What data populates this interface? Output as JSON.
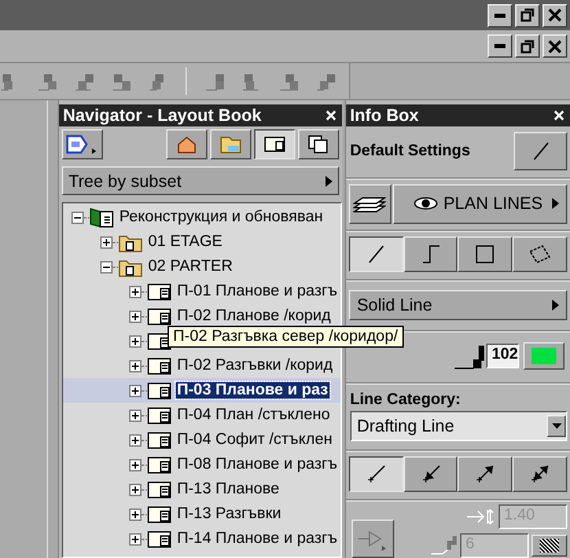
{
  "navigator": {
    "title": "Navigator - Layout Book",
    "view_buttons": [
      {
        "kind": "project",
        "selected": false
      },
      {
        "kind": "view",
        "selected": false
      },
      {
        "kind": "layout",
        "selected": true
      },
      {
        "kind": "publisher",
        "selected": false
      }
    ],
    "dropdown": "Tree by subset",
    "tree": [
      {
        "kind": "project",
        "label": "Реконструкция и обновяван",
        "expanded": true,
        "selected": false,
        "children": [
          {
            "kind": "folder",
            "label": "01 ETAGE",
            "expanded": false,
            "selected": false
          },
          {
            "kind": "folder",
            "label": "02 PARTER",
            "expanded": true,
            "selected": false,
            "children": [
              {
                "kind": "layout",
                "label": "П-01 Планове и разгъ",
                "expanded": false,
                "selected": false
              },
              {
                "kind": "layout",
                "label": "П-02 Планове /корид",
                "expanded": false,
                "selected": false
              },
              {
                "kind": "layout",
                "expanded": false,
                "selected": false
              },
              {
                "kind": "layout",
                "label": "П-02 Разгъвки /корид",
                "expanded": false,
                "selected": false
              },
              {
                "kind": "layout",
                "label": "П-03 Планове и раз",
                "expanded": false,
                "selected": true
              },
              {
                "kind": "layout",
                "label": "П-04 План /стъклено",
                "expanded": false,
                "selected": false
              },
              {
                "kind": "layout",
                "label": "П-04 Софит /стъклен",
                "expanded": false,
                "selected": false
              },
              {
                "kind": "layout",
                "label": "П-08 Планове и разгъ",
                "expanded": false,
                "selected": false
              },
              {
                "kind": "layout",
                "label": "П-13 Планове",
                "expanded": false,
                "selected": false
              },
              {
                "kind": "layout",
                "label": "П-13 Разгъвки",
                "expanded": false,
                "selected": false
              },
              {
                "kind": "layout",
                "label": "П-14 Планове и разгъ",
                "expanded": false,
                "selected": false
              }
            ]
          }
        ]
      }
    ],
    "tooltip": "П-02 Разгъвка север /коридор/"
  },
  "info_box": {
    "title": "Info Box",
    "heading": "Default Settings",
    "layer": "PLAN LINES",
    "geometry_buttons": [
      {
        "kind": "single",
        "selected": true
      },
      {
        "kind": "polyline",
        "selected": false
      },
      {
        "kind": "rectangle",
        "selected": false
      },
      {
        "kind": "rotated",
        "selected": false
      }
    ],
    "line_type": "Solid Line",
    "pen": "102",
    "category_label": "Line Category:",
    "category": "Drafting Line",
    "arrow_buttons": [
      {
        "kind": "none",
        "selected": true
      },
      {
        "kind": "start",
        "selected": false
      },
      {
        "kind": "end",
        "selected": false
      },
      {
        "kind": "both",
        "selected": false
      }
    ],
    "arrow_size": {
      "value": "1.40",
      "disabled": true
    },
    "arrow_pen": {
      "value": "6",
      "disabled": true
    }
  }
}
